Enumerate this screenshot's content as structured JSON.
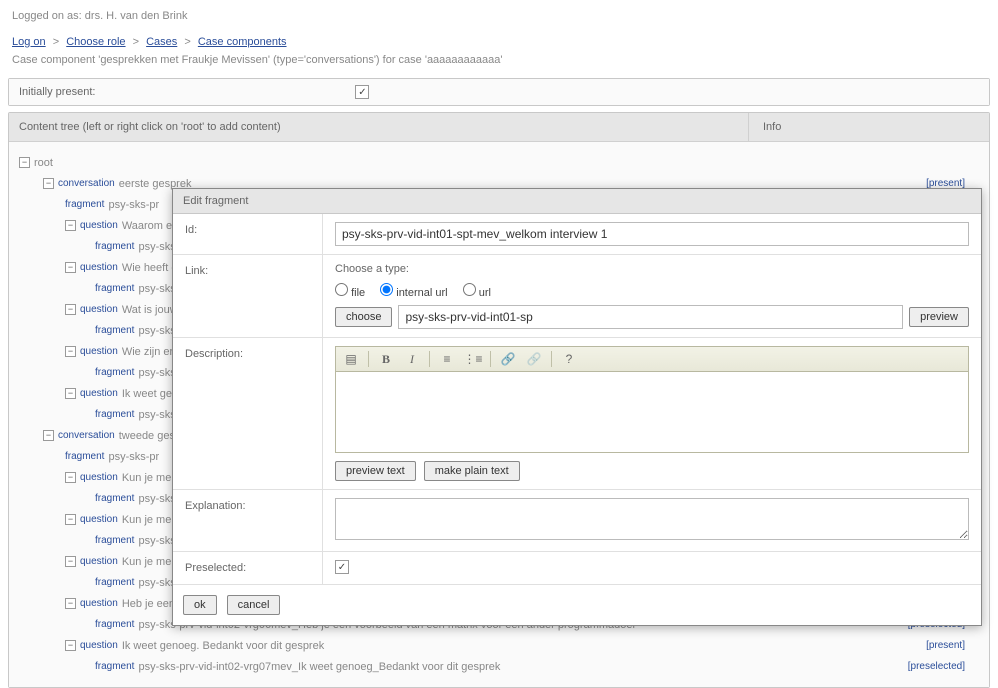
{
  "header": {
    "loggedOn": "Logged on as: drs. H. van den Brink"
  },
  "breadcrumb": {
    "logon": "Log on",
    "chooseRole": "Choose role",
    "cases": "Cases",
    "components": "Case components"
  },
  "subtitle": "Case component 'gesprekken met Fraukje Mevissen' (type='conversations') for case 'aaaaaaaaaaaa'",
  "initiallyPresent": {
    "label": "Initially present:"
  },
  "contentTree": {
    "header": "Content tree (left or right click on 'root' to add content)",
    "infoHeader": "Info"
  },
  "tree": {
    "root": "root",
    "convo1": "eerste gesprek",
    "present": "[present]",
    "frag1": "psy-sks-pr",
    "q1": "Waarom ee",
    "frag_q1": "psy-sks",
    "q2": "Wie heeft d",
    "frag_q2": "psy-sks",
    "q3": "Wat is jouw",
    "frag_q3": "psy-sks",
    "q4": "Wie zijn er n",
    "frag_q4": "psy-sks",
    "q5": "Ik weet gen",
    "frag_q5": "psy-sks",
    "convo2": "tweede ges",
    "frag2": "psy-sks-pr",
    "q6": "Kun je me d",
    "frag_q6": "psy-sks",
    "q7": "Kun je me u",
    "frag_q7": "psy-sks",
    "q8": "Kun je me u",
    "frag_q8": "psy-sks",
    "q9": "Heb je een",
    "frag_q9": "psy-sks-prv-vid-int02-vrg06mev_Heb je een voorbeeld van een matrix voor een ander programmadoel",
    "preselected": "[preselected]",
    "q10": "Ik weet genoeg. Bedankt voor dit gesprek",
    "frag_q10": "psy-sks-prv-vid-int02-vrg07mev_Ik weet genoeg_Bedankt voor dit gesprek",
    "tag_conv": "conversation",
    "tag_frag": "fragment",
    "tag_q": "question"
  },
  "modal": {
    "title": "Edit fragment",
    "idLabel": "Id:",
    "idValue": "psy-sks-prv-vid-int01-spt-mev_welkom interview 1",
    "linkLabel": "Link:",
    "chooseType": "Choose a type:",
    "radioFile": "file",
    "radioInternal": "internal url",
    "radioUrl": "url",
    "chooseBtn": "choose",
    "urlValue": "psy-sks-prv-vid-int01-sp",
    "previewBtn": "preview",
    "descLabel": "Description:",
    "previewText": "preview text",
    "makePlain": "make plain text",
    "explLabel": "Explanation:",
    "preselLabel": "Preselected:",
    "ok": "ok",
    "cancel": "cancel"
  }
}
